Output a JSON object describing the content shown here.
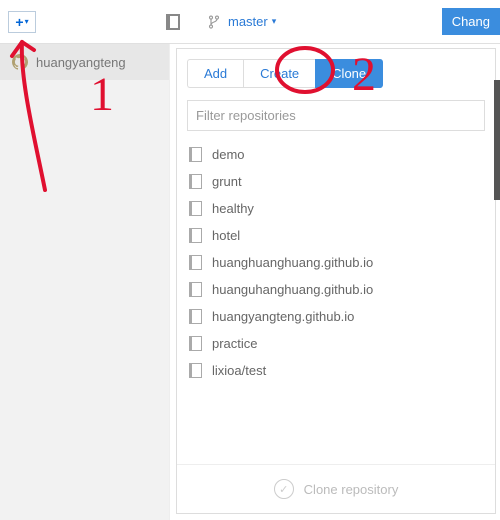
{
  "toolbar": {
    "branch_label": "master",
    "changes_label": "Chang"
  },
  "sidebar": {
    "items": [
      {
        "label": "huangyangteng"
      }
    ]
  },
  "panel": {
    "tabs": [
      {
        "label": "Add",
        "active": false
      },
      {
        "label": "Create",
        "active": false
      },
      {
        "label": "Clone",
        "active": true
      }
    ],
    "filter_placeholder": "Filter repositories",
    "repos": [
      "demo",
      "grunt",
      "healthy",
      "hotel",
      "huanghuanghuang.github.io",
      "huanguhanghuang.github.io",
      "huangyangteng.github.io",
      "practice",
      "lixioa/test"
    ],
    "footer_label": "Clone repository"
  },
  "annotations": {
    "label1": "1",
    "label2": "2"
  }
}
